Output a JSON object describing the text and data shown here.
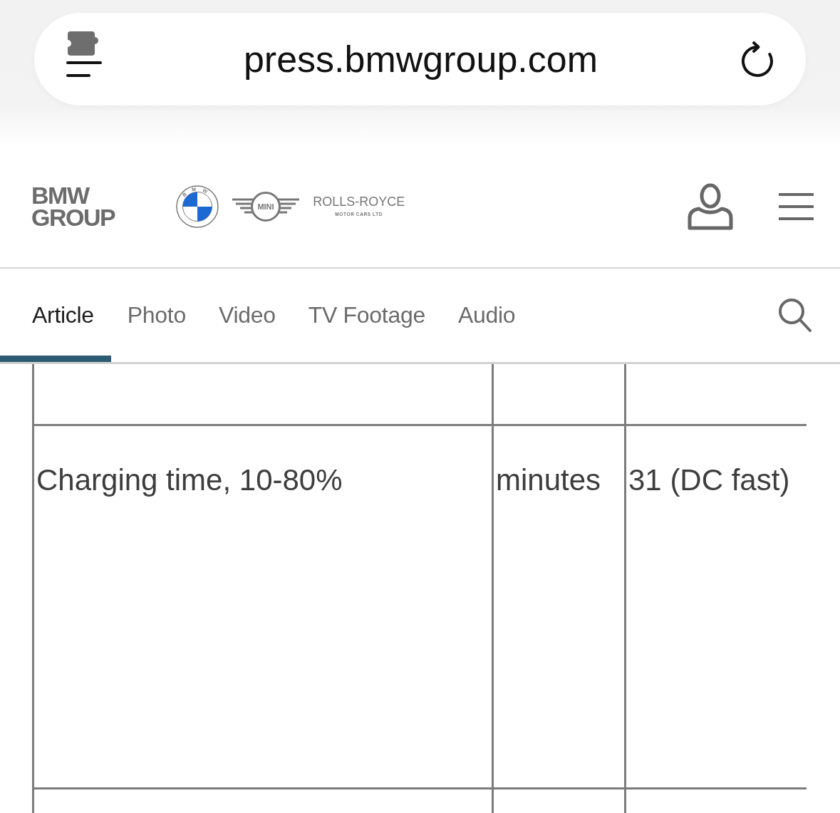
{
  "browser": {
    "url": "press.bmwgroup.com"
  },
  "header": {
    "brand_logo": "BMW GROUP",
    "sub_brands": [
      {
        "kind": "roundel",
        "label": "BMW"
      },
      {
        "kind": "wings",
        "label": "MINI"
      },
      {
        "kind": "wordmark",
        "label": "ROLLS-ROYCE",
        "tagline": "MOTOR CARS LTD"
      }
    ]
  },
  "tabs": [
    {
      "label": "Article",
      "selected": true
    },
    {
      "label": "Photo",
      "selected": false
    },
    {
      "label": "Video",
      "selected": false
    },
    {
      "label": "TV Footage",
      "selected": false
    },
    {
      "label": "Audio",
      "selected": false
    }
  ],
  "table": {
    "rows": [
      {
        "cells": [
          "Charging time, 10-80%",
          "minutes",
          "31 (DC fast)"
        ]
      }
    ]
  }
}
